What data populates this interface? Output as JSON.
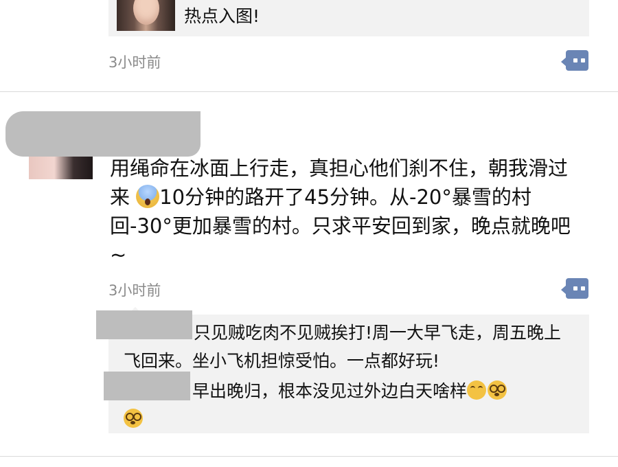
{
  "top_post": {
    "link_text": "热点入图!",
    "timestamp": "3小时前",
    "comment_icon": "comment-bubble-icon"
  },
  "post": {
    "text_part1": "用绳命在冰面上行走，真担心他们刹不住，朝我滑过来 ",
    "emoji": "face-screaming-in-fear",
    "text_part2": "10分钟的路开了45分钟。从-20°暴雪的村回-30°更加暴雪的村。只求平安回到家，晚点就晚吧~",
    "timestamp": "3小时前",
    "comment_icon": "comment-bubble-icon",
    "comments": [
      {
        "text": "只见贼吃肉不见贼挨打!周一大早飞走，周五晚上飞回来。坐小飞机担惊受怕。一点都好玩!"
      },
      {
        "text": "早出晚归，根本没见过外边白天啥样",
        "emojis": [
          "unamused-face",
          "dizzy-face",
          "dizzy-face"
        ]
      }
    ]
  },
  "colors": {
    "accent": "#6a85b5",
    "timestamp": "#8a8a8a",
    "card_bg": "#f2f2f2",
    "redaction": "#bdbdbd"
  }
}
